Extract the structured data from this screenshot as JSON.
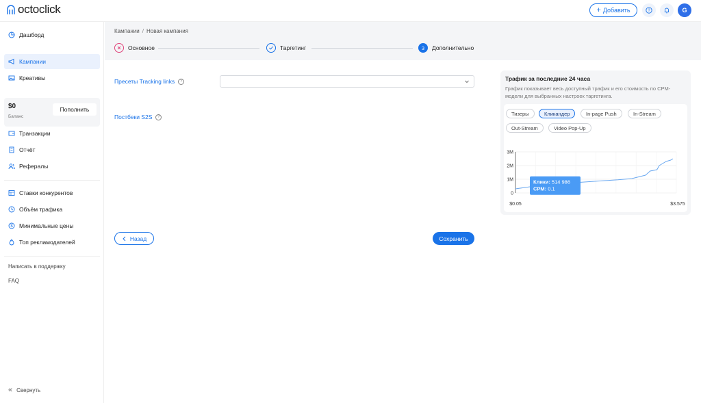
{
  "header": {
    "logo_text": "octoclick",
    "add_label": "Добавить",
    "avatar_letter": "G",
    "accent_color": "#1a73e8"
  },
  "sidebar": {
    "items": [
      {
        "label": "Дашборд",
        "icon": "pie-chart-icon"
      },
      {
        "label": "Кампании",
        "icon": "megaphone-icon",
        "active": true
      },
      {
        "label": "Креативы",
        "icon": "image-icon"
      },
      {
        "label": "Транзакции",
        "icon": "wallet-icon"
      },
      {
        "label": "Отчёт",
        "icon": "report-icon"
      },
      {
        "label": "Рефералы",
        "icon": "users-icon"
      },
      {
        "label": "Ставки конкурентов",
        "icon": "table-icon"
      },
      {
        "label": "Объём трафика",
        "icon": "clock-chart-icon"
      },
      {
        "label": "Минимальные цены",
        "icon": "dollar-icon"
      },
      {
        "label": "Топ рекламодателей",
        "icon": "flame-icon"
      }
    ],
    "balance": {
      "amount": "$0",
      "label": "Баланс",
      "topup_label": "Пополнить"
    },
    "support_label": "Написать в поддержку",
    "faq_label": "FAQ",
    "collapse_label": "Свернуть"
  },
  "breadcrumb": {
    "root": "Кампании",
    "separator": "/",
    "current": "Новая кампания"
  },
  "steps": [
    {
      "label": "Основное",
      "state": "error"
    },
    {
      "label": "Таргетинг",
      "state": "done"
    },
    {
      "label": "Дополнительно",
      "state": "current",
      "number": "3"
    }
  ],
  "form": {
    "presets_label": "Пресеты Tracking links",
    "presets_value": "",
    "postbacks_label": "Постбеки S2S",
    "back_label": "Назад",
    "save_label": "Сохранить"
  },
  "traffic": {
    "title": "Трафик за последние 24 часа",
    "description": "График показывает весь доступный трафик и его стоимость по CPM-модели для выбранных настроек таргетинга.",
    "tabs": [
      {
        "label": "Тизеры"
      },
      {
        "label": "Кликандер",
        "selected": true
      },
      {
        "label": "In-page Push"
      },
      {
        "label": "In-Stream"
      },
      {
        "label": "Out-Stream"
      },
      {
        "label": "Video Pop-Up"
      }
    ],
    "tooltip": {
      "clicks_label": "Клики:",
      "clicks_value": "514 986",
      "cpm_label": "CPM:",
      "cpm_value": "0.1"
    }
  },
  "chart_data": {
    "type": "line",
    "y_tick_labels": [
      "3M",
      "2M",
      "1M",
      "0"
    ],
    "x_tick_labels": [
      "$0.05",
      "$3.575"
    ],
    "xlim": [
      0.05,
      3.575
    ],
    "ylim": [
      0,
      3000000
    ],
    "grid": true,
    "x": [
      0.05,
      0.3,
      0.5,
      0.8,
      1.1,
      1.4,
      1.7,
      2.0,
      2.3,
      2.6,
      2.9,
      3.0,
      3.15,
      3.2,
      3.25,
      3.35,
      3.45,
      3.5
    ],
    "values": [
      300000,
      420000,
      514986,
      600000,
      680000,
      760000,
      830000,
      900000,
      960000,
      1050000,
      1300000,
      1600000,
      1700000,
      2000000,
      2100000,
      2300000,
      2400000,
      2500000
    ]
  }
}
